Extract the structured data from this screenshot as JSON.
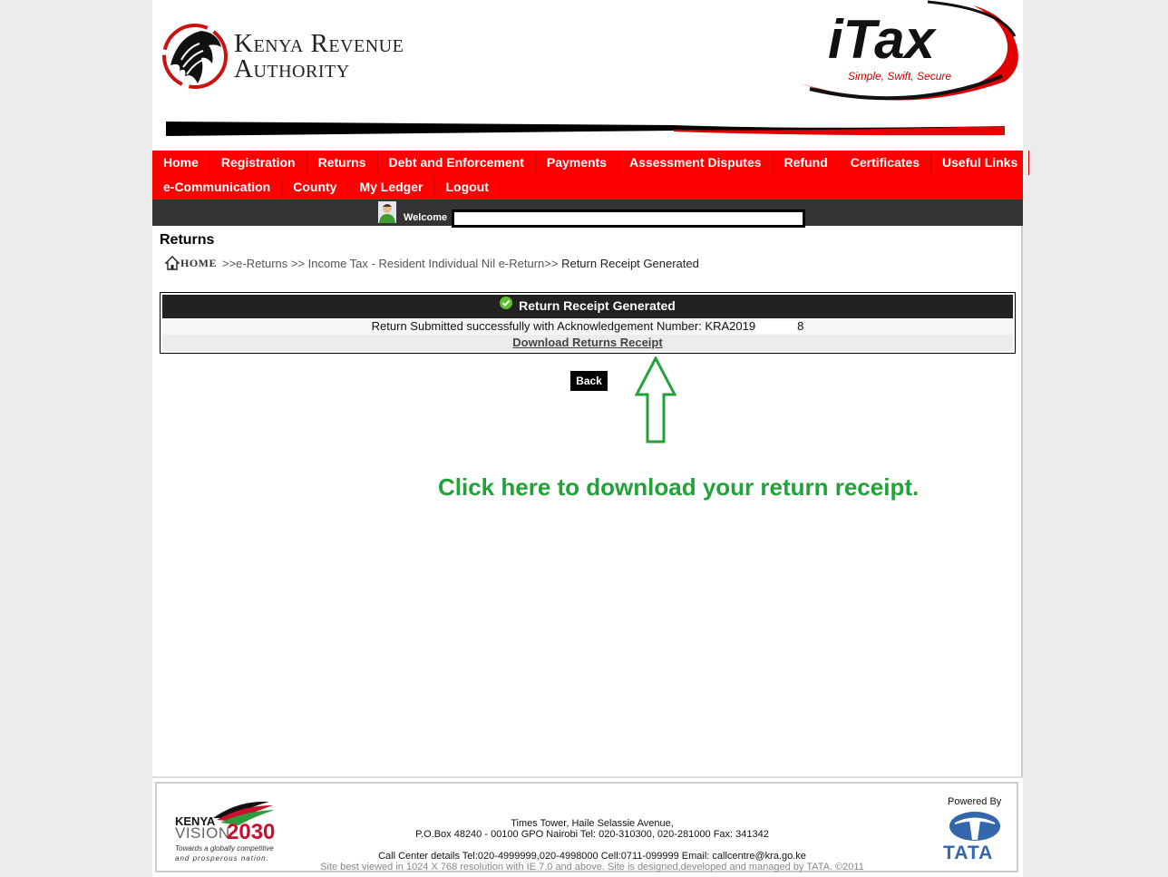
{
  "header": {
    "kra_line1": "Kenya Revenue",
    "kra_line2": "Authority",
    "itax_title": "iTax",
    "itax_tagline": "Simple, Swift, Secure"
  },
  "nav": {
    "row1": [
      "Home",
      "Registration",
      "Returns",
      "Debt and Enforcement",
      "Payments",
      "Assessment Disputes",
      "Refund",
      "Certificates",
      "Useful Links"
    ],
    "row2": [
      "e-Communication",
      "County",
      "My Ledger",
      "Logout"
    ]
  },
  "welcome": {
    "label": "Welcome"
  },
  "page": {
    "section_title": "Returns",
    "breadcrumb_home": "HOME",
    "breadcrumb_path": ">>e-Returns >> Income Tax - Resident Individual Nil e-Return>>",
    "breadcrumb_current": " Return Receipt Generated"
  },
  "receipt": {
    "header": "Return Receipt Generated",
    "message": "Return Submitted successfully with Acknowledgement Number: KRA2019",
    "ack_suffix": "8",
    "download_label": "Download Returns Receipt"
  },
  "actions": {
    "back_label": "Back"
  },
  "annotation": {
    "text": "Click here to download your return receipt."
  },
  "footer": {
    "vision_kenya": "KENYA",
    "vision_word": "VISION",
    "vision_year": "2030",
    "vision_tag1": "Towards a globally competitive",
    "vision_tag2": "and prosperous nation.",
    "address1": "Times Tower, Haile Selassie Avenue,",
    "address2": "P.O.Box 48240 - 00100 GPO Nairobi Tel: 020-310300, 020-281000 Fax: 341342",
    "call_center": "Call Center details Tel:020-4999999,020-4998000 Cell:0711-099999 Email: callcentre@kra.go.ke",
    "site_note": "Site best viewed in 1024 X 768 resolution with IE 7.0 and above. Site is designed,developed and managed by TATA. ©2011",
    "powered_by": "Powered By",
    "tata": "TATA"
  },
  "colors": {
    "nav_red": "#ff0000",
    "welcome_bar": "#333333",
    "annotation_green": "#22a33a",
    "vision_red": "#c8102e",
    "tata_blue": "#3366aa"
  }
}
